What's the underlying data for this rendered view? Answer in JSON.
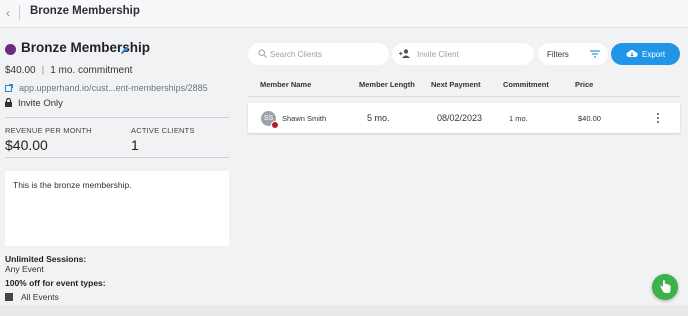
{
  "header": {
    "title": "Bronze Membership",
    "back_icon": "chevron-left-icon"
  },
  "membership": {
    "name": "Bronze Membership",
    "color": "#6b2b7f",
    "price": "$40.00",
    "commitment": "1 mo. commitment",
    "link": "app.upperhand.io/cust...ent-memberships/2885",
    "visibility": "Invite Only"
  },
  "stats": {
    "revenue_label": "REVENUE PER MONTH",
    "revenue_value": "$40.00",
    "clients_label": "ACTIVE CLIENTS",
    "clients_value": "1"
  },
  "description": "This is the bronze membership.",
  "benefits": {
    "sessions_label": "Unlimited Sessions:",
    "sessions_value": "Any Event",
    "discount_label": "100% off for event types:",
    "event_value": "All Events"
  },
  "toolbar": {
    "search_placeholder": "Search Clients",
    "invite_placeholder": "Invite Client",
    "filters_label": "Filters",
    "export_label": "Export"
  },
  "table": {
    "headers": [
      "Member Name",
      "Member Length",
      "Next Payment",
      "Commitment",
      "Price"
    ],
    "rows": [
      {
        "initials": "SS",
        "name": "Shawn Smith",
        "length": "5 mo.",
        "next_payment": "08/02/2023",
        "commitment": "1 mo.",
        "price": "$40.00"
      }
    ]
  },
  "colors": {
    "accent": "#2196e9",
    "fab": "#3bb24a",
    "status_alert": "#b3202b"
  }
}
